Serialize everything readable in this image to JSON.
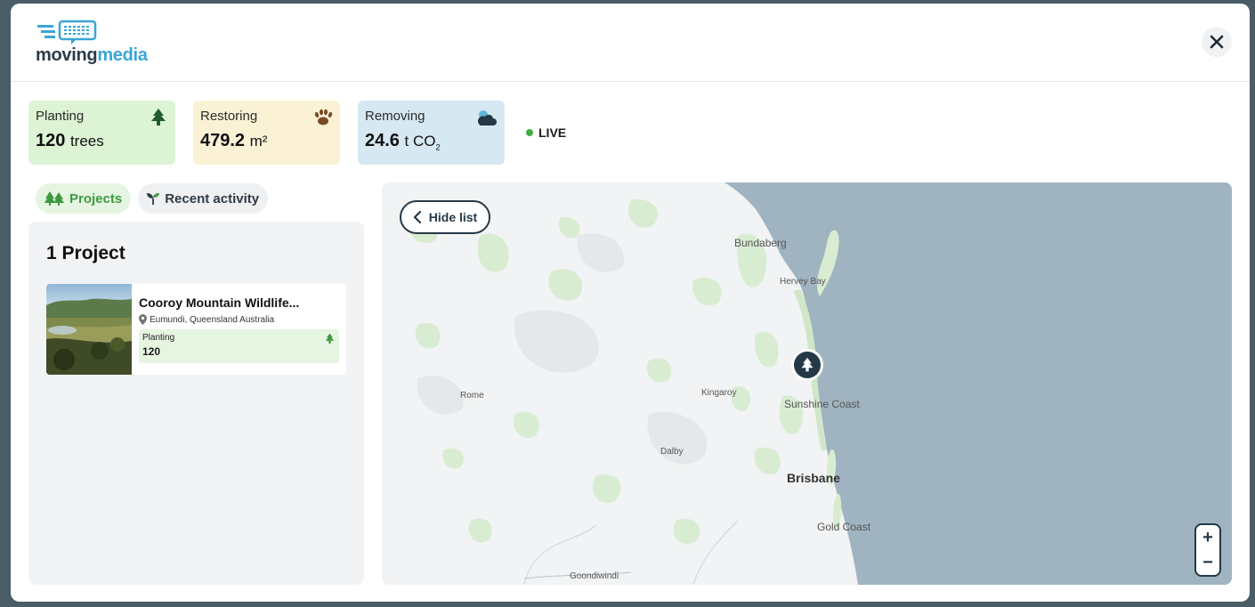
{
  "logo": {
    "part1": "moving",
    "part2": "media"
  },
  "stats": {
    "planting": {
      "label": "Planting",
      "value": "120",
      "unit": "trees"
    },
    "restoring": {
      "label": "Restoring",
      "value": "479.2",
      "unit": "m²"
    },
    "removing": {
      "label": "Removing",
      "value": "24.6",
      "unit": "t CO",
      "unit_sub": "2"
    },
    "live": "LIVE"
  },
  "tabs": {
    "projects": "Projects",
    "recent": "Recent activity"
  },
  "panel": {
    "title": "1 Project",
    "projects": [
      {
        "name": "Cooroy Mountain Wildlife...",
        "location": "Eumundi, Queensland Australia",
        "stat_label": "Planting",
        "stat_value": "120"
      }
    ]
  },
  "map": {
    "hide_list": "Hide list",
    "places": {
      "bundaberg": "Bundaberg",
      "hervey_bay": "Hervey Bay",
      "rome": "Rome",
      "kingaroy": "Kingaroy",
      "sunshine_coast": "Sunshine Coast",
      "dalby": "Dalby",
      "brisbane": "Brisbane",
      "gold_coast": "Gold Coast",
      "goondiwindi": "Goondiwindi"
    },
    "zoom_in": "+",
    "zoom_out": "−"
  },
  "colors": {
    "accent_green": "#3d9a3e",
    "navy": "#253845",
    "sea": "#9fb4c0",
    "live": "#3fae44"
  }
}
